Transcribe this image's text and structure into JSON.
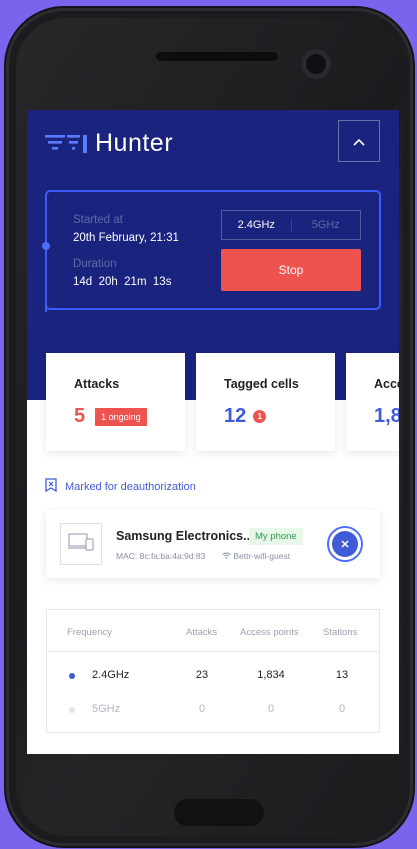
{
  "app": {
    "logo_prefix": "WIFI",
    "logo_suffix": "Hunter"
  },
  "session": {
    "started_label": "Started at",
    "started_value": "20th February, 21:31",
    "duration_label": "Duration",
    "duration_value": "14d  20h  21m  13s",
    "freq_options": [
      "2.4GHz",
      "5GHz"
    ],
    "freq_selected": "2.4GHz",
    "stop_label": "Stop"
  },
  "stats": [
    {
      "title": "Attacks",
      "value": "5",
      "pill": "1 ongoing",
      "color": "#ef5350"
    },
    {
      "title": "Tagged cells",
      "value": "12",
      "badge": "1",
      "color": "#3f5bd8"
    },
    {
      "title": "Acce",
      "value": "1,8",
      "color": "#3f5bd8"
    }
  ],
  "marked": {
    "heading": "Marked for deauthorization",
    "device": {
      "name": "Samsung Electronics...",
      "tag": "My phone",
      "mac": "MAC: 8c:fa:ba:4a:9d:83",
      "network": "Bettr-wifi-guest"
    }
  },
  "table": {
    "headers": [
      "Frequency",
      "Attacks",
      "Access points",
      "Stations"
    ],
    "rows": [
      {
        "freq": "2.4GHz",
        "attacks": "23",
        "access_points": "1,834",
        "stations": "13",
        "active": true
      },
      {
        "freq": "5GHz",
        "attacks": "0",
        "access_points": "0",
        "stations": "0",
        "active": false
      }
    ]
  },
  "colors": {
    "background": "#7b63ee",
    "hero": "#1a237e",
    "accent": "#3f5bd8",
    "danger": "#ef5350"
  }
}
